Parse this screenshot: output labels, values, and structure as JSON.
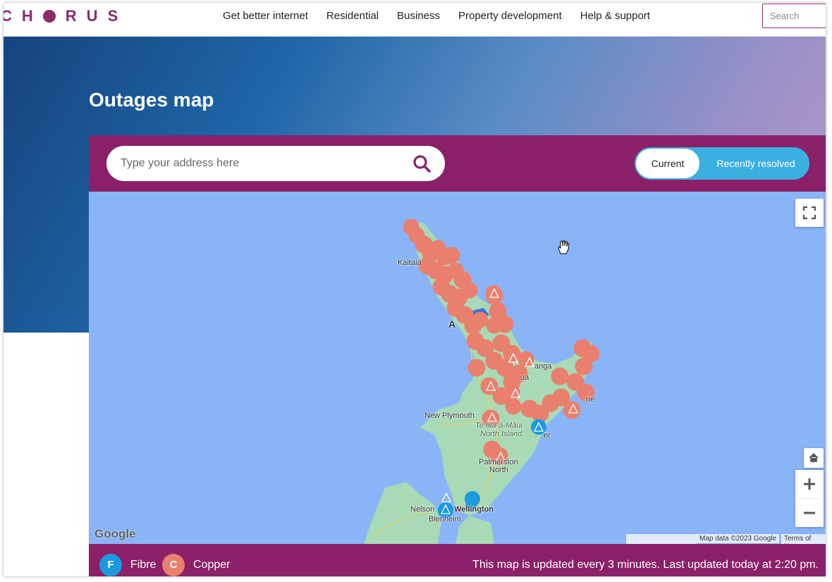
{
  "header": {
    "logo_text": "CHORUS",
    "nav": [
      "Get better internet",
      "Residential",
      "Business",
      "Property development",
      "Help & support"
    ],
    "search_placeholder": "Search"
  },
  "page": {
    "title": "Outages map"
  },
  "address_search": {
    "placeholder": "Type your address here"
  },
  "view_toggle": {
    "current": "Current",
    "recently_resolved": "Recently resolved",
    "selected": "Current"
  },
  "map": {
    "labels": [
      "Kaitaia",
      "A",
      "anga",
      "ua",
      "ne",
      "New Plymouth",
      "Te Ika-a-Māui",
      "North Island",
      "Palmerston",
      "North",
      "Nelson",
      "Wellington",
      "Blenheim",
      "er"
    ],
    "attribution": "Map data ©2023 Google",
    "terms": "Terms of Use",
    "google": "Google"
  },
  "legend": {
    "fibre_letter": "F",
    "fibre_label": "Fibre",
    "copper_letter": "C",
    "copper_label": "Copper",
    "updated_text": "This map is updated every 3 minutes. Last updated today at 2:20 pm."
  },
  "colors": {
    "brand": "#8a2168",
    "fibre": "#1a9be0",
    "copper": "#e9806e",
    "toggle": "#3bb0e0"
  }
}
